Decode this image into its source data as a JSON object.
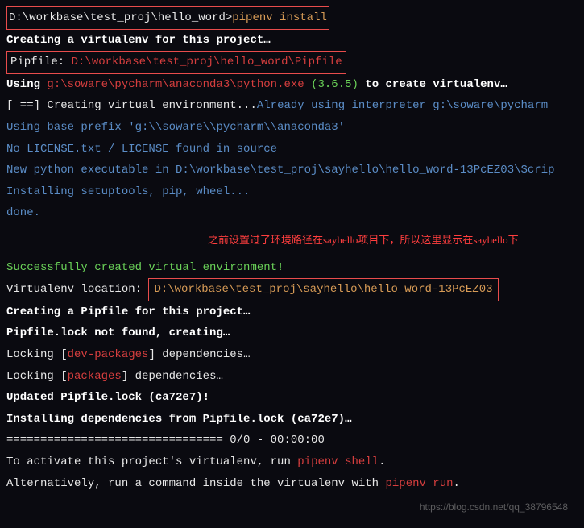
{
  "line1": {
    "prompt": "D:\\workbase\\test_proj\\hello_word>",
    "command": "pipenv install"
  },
  "line2": "Creating a virtualenv for this project…",
  "line3": {
    "label": "Pipfile: ",
    "path": "D:\\workbase\\test_proj\\hello_word\\Pipfile"
  },
  "line4": {
    "using": "Using ",
    "python_path": "g:\\soware\\pycharm\\anaconda3\\python.exe",
    "version": " (3.6.5) ",
    "suffix": "to create virtualenv…"
  },
  "line5": {
    "status": "[  ==] ",
    "text": "Creating virtual environment...",
    "already": "Already using interpreter g:\\soware\\pycharm"
  },
  "line6": "Using base prefix 'g:\\\\soware\\\\pycharm\\\\anaconda3'",
  "line7": "  No LICENSE.txt / LICENSE found in source",
  "line8": "New python executable in D:\\workbase\\test_proj\\sayhello\\hello_word-13PcEZ03\\Scrip",
  "line9": "Installing setuptools, pip, wheel...",
  "line10": "done.",
  "annotation": "之前设置过了环境路径在sayhello项目下，所以这里显示在sayhello下",
  "line11": "Successfully created virtual environment!",
  "line12": {
    "label": "Virtualenv location: ",
    "path": "D:\\workbase\\test_proj\\sayhello\\hello_word-13PcEZ03"
  },
  "line13": "Creating a Pipfile for this project…",
  "line14": "Pipfile.lock not found, creating…",
  "line15": {
    "locking": "Locking ",
    "bracket_open": "[",
    "pkg": "dev-packages",
    "bracket_close": "]",
    "deps": " dependencies…"
  },
  "line16": {
    "locking": "Locking ",
    "bracket_open": "[",
    "pkg": "packages",
    "bracket_close": "]",
    "deps": " dependencies…"
  },
  "line17": "Updated Pipfile.lock (ca72e7)!",
  "line18": "Installing dependencies from Pipfile.lock (ca72e7)…",
  "line19": "  ================================ 0/0 - 00:00:00",
  "line20": {
    "prefix": "To activate this project's virtualenv, run ",
    "cmd": "pipenv shell",
    "dot": "."
  },
  "line21": {
    "prefix": "Alternatively, run a command inside the virtualenv with ",
    "cmd": "pipenv run",
    "dot": "."
  },
  "watermark": "https://blog.csdn.net/qq_38796548"
}
